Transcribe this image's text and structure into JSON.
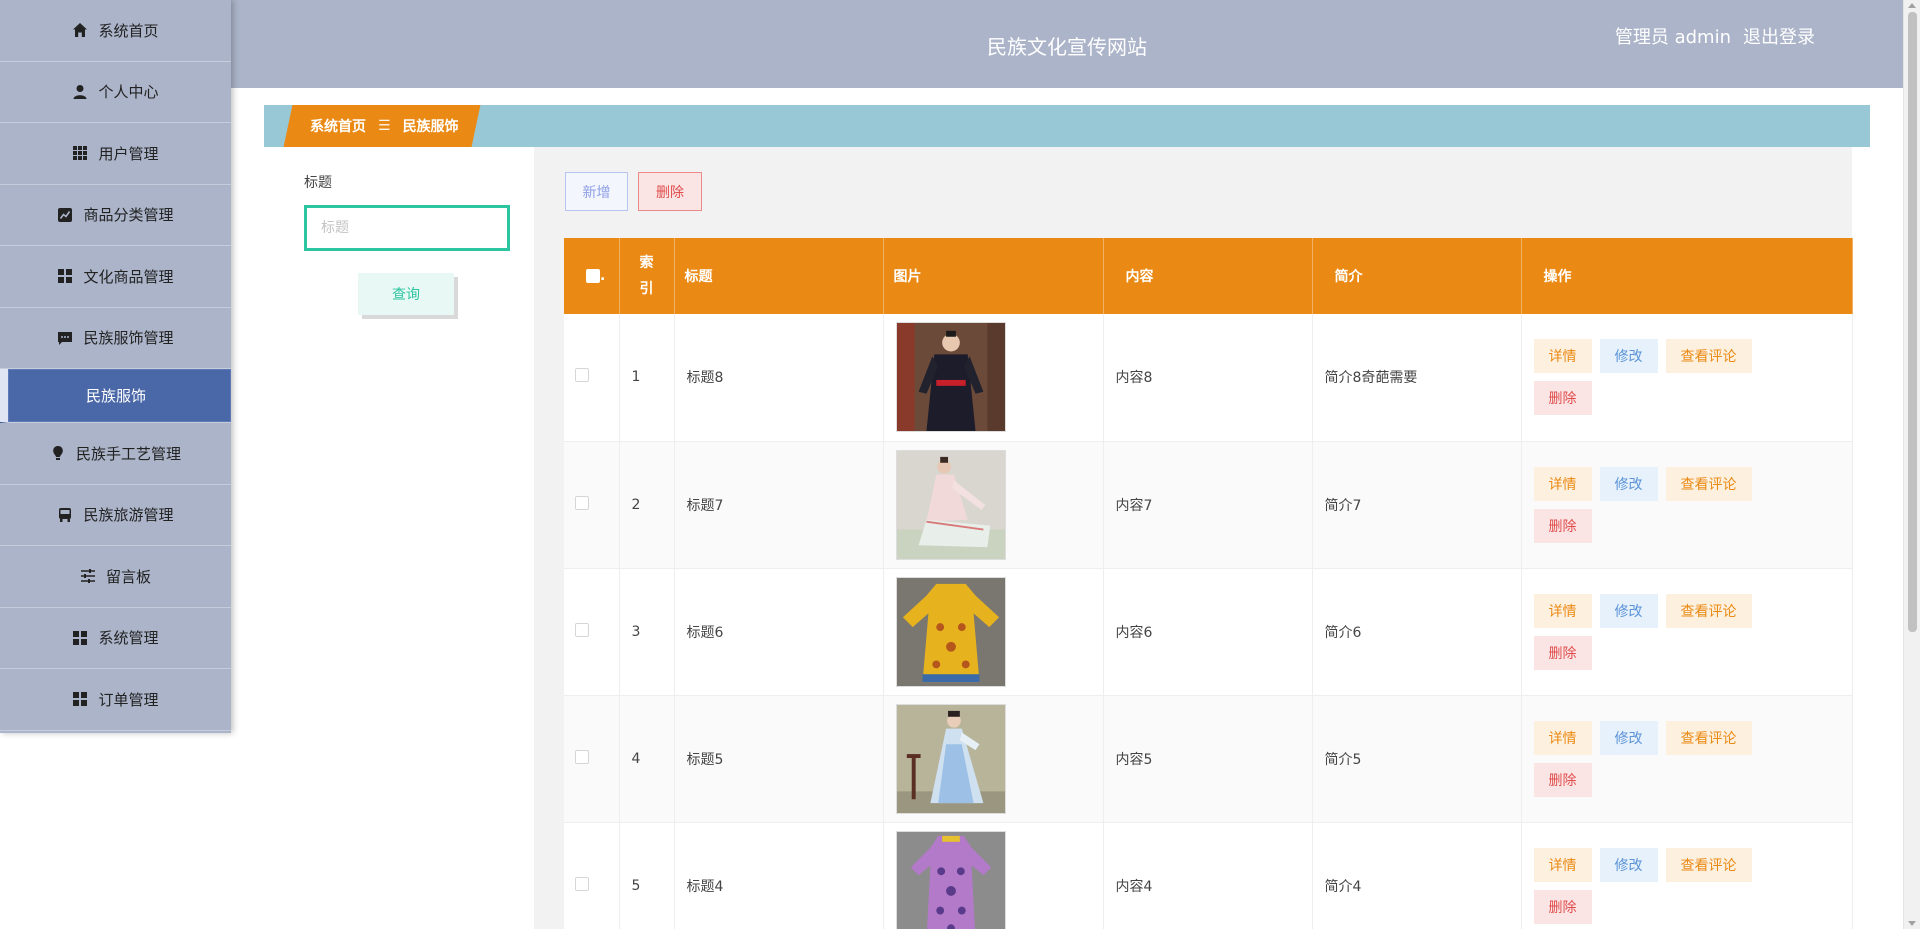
{
  "header": {
    "title": "民族文化宣传网站",
    "user_label": "管理员 admin",
    "logout_label": "退出登录"
  },
  "sidebar": {
    "items": [
      {
        "label": "系统首页",
        "icon": "home-icon"
      },
      {
        "label": "个人中心",
        "icon": "user-icon"
      },
      {
        "label": "用户管理",
        "icon": "grid-icon"
      },
      {
        "label": "商品分类管理",
        "icon": "chart-icon"
      },
      {
        "label": "文化商品管理",
        "icon": "apps-icon"
      },
      {
        "label": "民族服饰管理",
        "icon": "message-icon"
      },
      {
        "label": "民族服饰",
        "icon": "",
        "active": true
      },
      {
        "label": "民族手工艺管理",
        "icon": "bulb-icon"
      },
      {
        "label": "民族旅游管理",
        "icon": "bus-icon"
      },
      {
        "label": "留言板",
        "icon": "sliders-icon"
      },
      {
        "label": "系统管理",
        "icon": "apps-icon"
      },
      {
        "label": "订单管理",
        "icon": "apps-icon"
      }
    ]
  },
  "breadcrumb": {
    "home": "系统首页",
    "separator": "☰",
    "current": "民族服饰"
  },
  "search": {
    "label": "标题",
    "placeholder": "标题",
    "button": "查询"
  },
  "toolbar": {
    "add_label": "新增",
    "delete_label": "删除"
  },
  "table": {
    "headers": {
      "index": "索引",
      "title": "标题",
      "image": "图片",
      "content": "内容",
      "intro": "简介",
      "actions": "操作"
    },
    "actions": {
      "detail": "详情",
      "edit": "修改",
      "comments": "查看评论",
      "delete": "删除"
    },
    "rows": [
      {
        "index": "1",
        "title": "标题8",
        "image": "costume-photo-1",
        "content": "内容8",
        "intro": "简介8奇葩需要"
      },
      {
        "index": "2",
        "title": "标题7",
        "image": "costume-photo-2",
        "content": "内容7",
        "intro": "简介7"
      },
      {
        "index": "3",
        "title": "标题6",
        "image": "costume-photo-3",
        "content": "内容6",
        "intro": "简介6"
      },
      {
        "index": "4",
        "title": "标题5",
        "image": "costume-photo-4",
        "content": "内容5",
        "intro": "简介5"
      },
      {
        "index": "5",
        "title": "标题4",
        "image": "costume-photo-5",
        "content": "内容4",
        "intro": "简介4"
      }
    ]
  },
  "colors": {
    "sidebar_bg": "#abb4c9",
    "active_item": "#4a68a8",
    "accent_orange": "#ea8a14",
    "breadcrumb_bar": "#98c8d6",
    "search_border": "#2dc4a0"
  }
}
